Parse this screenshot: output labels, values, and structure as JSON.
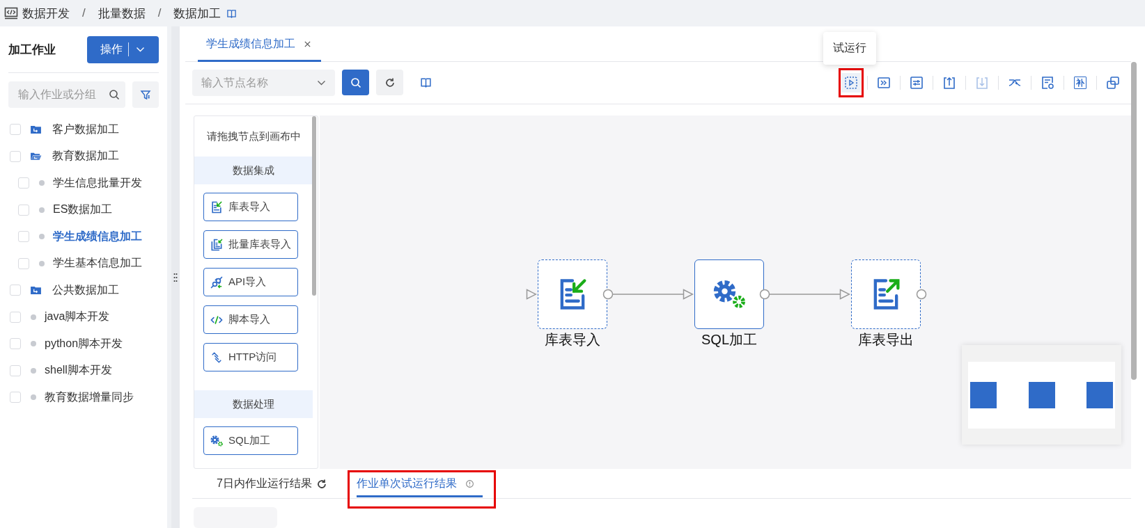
{
  "breadcrumb": [
    {
      "label": "数据开发",
      "separator": "/"
    },
    {
      "label": "批量数据",
      "separator": "/"
    },
    {
      "label": "数据加工"
    }
  ],
  "sidebar": {
    "title": "加工作业",
    "action_button": "操作",
    "search": {
      "placeholder": "输入作业或分组"
    },
    "tree": [
      {
        "label": "客户数据加工",
        "kind": "folder",
        "checked": false,
        "selected": false,
        "expanded": false
      },
      {
        "label": "教育数据加工",
        "kind": "folder",
        "checked": false,
        "selected": false,
        "expanded": true,
        "children": [
          {
            "label": "学生信息批量开发",
            "kind": "job",
            "checked": false,
            "selected": false
          },
          {
            "label": "ES数据加工",
            "kind": "job",
            "checked": false,
            "selected": false
          },
          {
            "label": "学生成绩信息加工",
            "kind": "job",
            "checked": false,
            "selected": true
          },
          {
            "label": "学生基本信息加工",
            "kind": "job",
            "checked": false,
            "selected": false
          }
        ]
      },
      {
        "label": "公共数据加工",
        "kind": "folder",
        "checked": false,
        "selected": false,
        "expanded": false
      },
      {
        "label": "java脚本开发",
        "kind": "job",
        "checked": false,
        "selected": false
      },
      {
        "label": "python脚本开发",
        "kind": "job",
        "checked": false,
        "selected": false
      },
      {
        "label": "shell脚本开发",
        "kind": "job",
        "checked": false,
        "selected": false
      },
      {
        "label": "教育数据增量同步",
        "kind": "job",
        "checked": false,
        "selected": false
      }
    ]
  },
  "editor_tabs": [
    {
      "label": "学生成绩信息加工",
      "selected": true
    }
  ],
  "toolbar": {
    "node_search": {
      "placeholder": "输入节点名称"
    },
    "actions": [
      {
        "kind": "trial-run",
        "tooltip": "试运行",
        "highlighted": true,
        "disabled": false
      },
      {
        "kind": "run-all",
        "highlighted": false,
        "disabled": false
      },
      {
        "kind": "params",
        "highlighted": false,
        "disabled": false
      },
      {
        "kind": "submit",
        "highlighted": false,
        "disabled": false
      },
      {
        "kind": "download",
        "highlighted": false,
        "disabled": true
      },
      {
        "kind": "helix",
        "highlighted": false,
        "disabled": false
      },
      {
        "kind": "log",
        "highlighted": false,
        "disabled": false
      },
      {
        "kind": "supplement",
        "label": "补",
        "highlighted": false,
        "disabled": false
      },
      {
        "kind": "copy",
        "highlighted": false,
        "disabled": false
      }
    ]
  },
  "palette": {
    "hint": "请拖拽节点到画布中",
    "groups": [
      {
        "title": "数据集成",
        "items": [
          {
            "label": "库表导入",
            "kind": "table-import"
          },
          {
            "label": "批量库表导入",
            "kind": "batch-import"
          },
          {
            "label": "API导入",
            "kind": "api"
          },
          {
            "label": "脚本导入",
            "kind": "script"
          },
          {
            "label": "HTTP访问",
            "kind": "http"
          }
        ]
      },
      {
        "title": "数据处理",
        "items": [
          {
            "label": "SQL加工",
            "kind": "sql"
          }
        ]
      }
    ]
  },
  "canvas": {
    "nodes": [
      {
        "label": "库表导入",
        "kind": "table-import",
        "configured": false
      },
      {
        "label": "SQL加工",
        "kind": "sql",
        "configured": true
      },
      {
        "label": "库表导出",
        "kind": "table-export",
        "configured": false
      }
    ]
  },
  "result_tabs": [
    {
      "label": "7日内作业运行结果",
      "kind": "refresh",
      "selected": false,
      "highlighted": false
    },
    {
      "label": "作业单次试运行结果",
      "kind": "info",
      "selected": true,
      "highlighted": true
    }
  ]
}
